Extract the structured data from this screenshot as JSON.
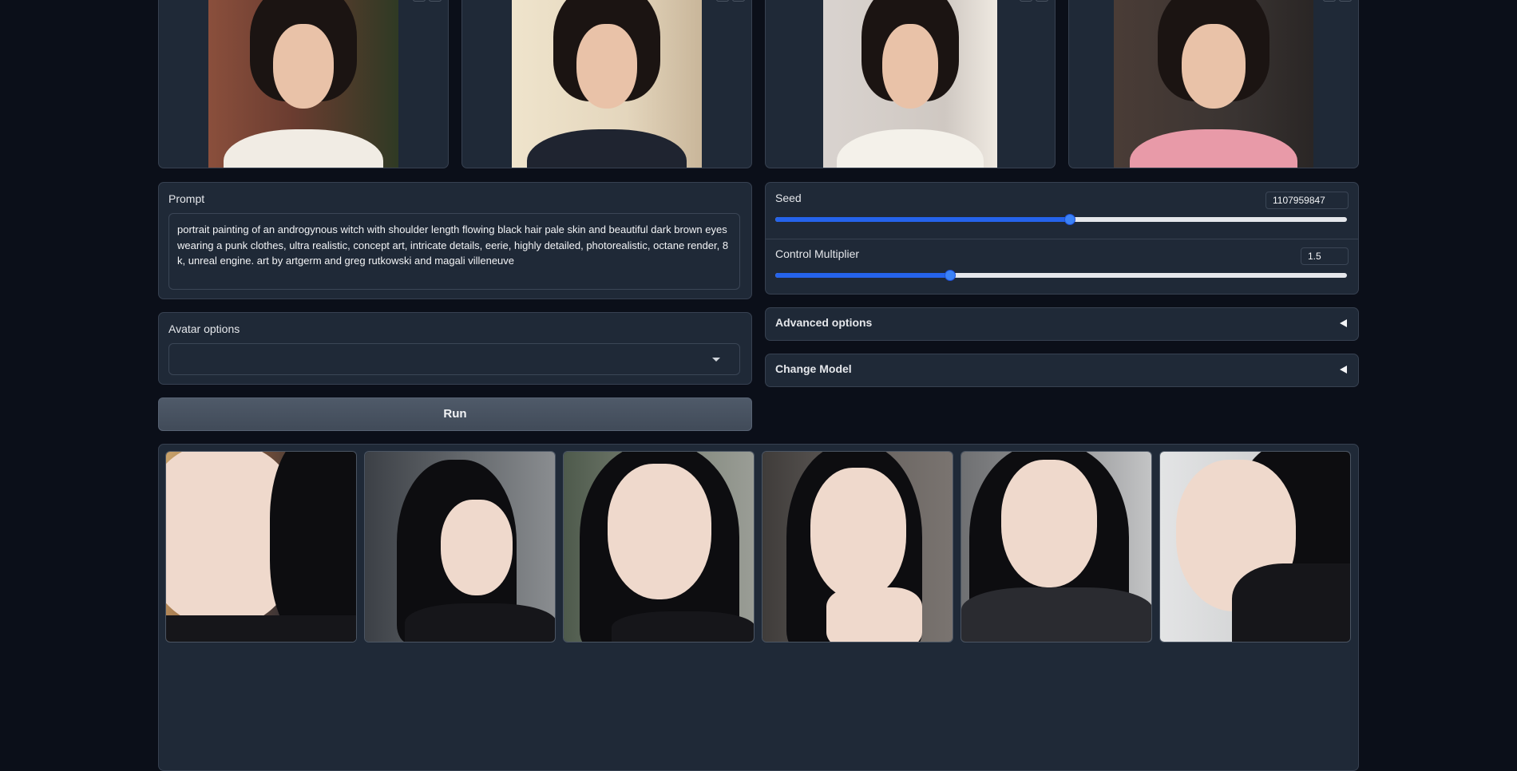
{
  "input_images": {
    "items": [
      {
        "alt": "",
        "bg": "#7a4a3a",
        "body": "#f1ece4"
      },
      {
        "alt": "",
        "bg": "#e9dcc6",
        "body": "#1f2430"
      },
      {
        "alt": "",
        "bg": "#d8d2cd",
        "body": "#f4f1ea"
      },
      {
        "alt": "",
        "bg": "#3a3432",
        "body": "#e89aa8"
      }
    ]
  },
  "prompt": {
    "label": "Prompt",
    "value": "portrait painting of an androgynous witch with shoulder length flowing black hair pale skin and beautiful dark brown eyes wearing a punk clothes, ultra realistic, concept art, intricate details, eerie, highly detailed, photorealistic, octane render, 8 k, unreal engine. art by artgerm and greg rutkowski and magali villeneuve"
  },
  "avatar_options": {
    "label": "Avatar options",
    "value": ""
  },
  "run_button": {
    "label": "Run"
  },
  "seed": {
    "label": "Seed",
    "value": "1107959847",
    "fraction": 0.516
  },
  "control_multiplier": {
    "label": "Control Multiplier",
    "value": "1.5",
    "fraction": 0.306
  },
  "advanced_options": {
    "label": "Advanced options"
  },
  "change_model": {
    "label": "Change Model"
  },
  "gallery": {
    "items": [
      {
        "bg": "#6b5a4a"
      },
      {
        "bg": "#5a5f63"
      },
      {
        "bg": "#6d7368"
      },
      {
        "bg": "#5c5a58"
      },
      {
        "bg": "#8a8c8e"
      },
      {
        "bg": "#d9dadb"
      }
    ]
  },
  "colors": {
    "background": "#0b0f19",
    "panel": "#1f2937",
    "accent": "#2563eb"
  }
}
